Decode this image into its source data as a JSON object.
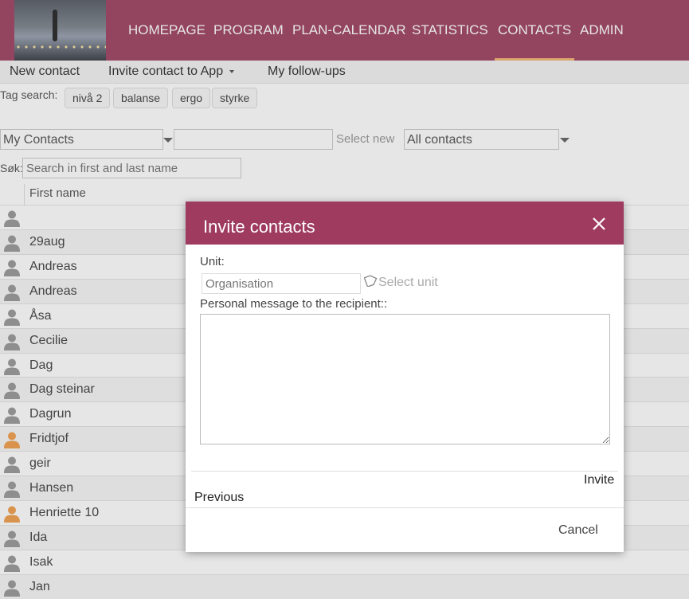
{
  "nav": {
    "items": [
      "HOMEPAGE",
      "PROGRAM",
      "PLAN-CALENDAR",
      "STATISTICS",
      "CONTACTS",
      "ADMIN"
    ],
    "active": "CONTACTS",
    "accent_color": "#a04565",
    "active_underline_color": "#f2b474"
  },
  "toolbar": {
    "new_contact": "New contact",
    "invite_contact": "Invite contact to App",
    "follow_ups": "My follow-ups"
  },
  "tag_search": {
    "label": "Tag search:",
    "tags": [
      "nivå 2",
      "balanse",
      "ergo",
      "styrke"
    ]
  },
  "filters": {
    "list_select": "My Contacts",
    "select_new_label": "Select new",
    "scope_select": "All contacts"
  },
  "search": {
    "label": "Søk:",
    "placeholder": "Search in first and last name"
  },
  "table": {
    "column_first_name": "First name",
    "rows": [
      {
        "name": "",
        "avatar": "gray"
      },
      {
        "name": "29aug",
        "avatar": "gray"
      },
      {
        "name": "Andreas",
        "avatar": "gray"
      },
      {
        "name": "Andreas",
        "avatar": "gray"
      },
      {
        "name": "Åsa",
        "avatar": "gray"
      },
      {
        "name": "Cecilie",
        "avatar": "gray"
      },
      {
        "name": "Dag",
        "avatar": "gray"
      },
      {
        "name": "Dag steinar",
        "avatar": "gray"
      },
      {
        "name": "Dagrun",
        "avatar": "gray"
      },
      {
        "name": "Fridtjof",
        "avatar": "orange"
      },
      {
        "name": "geir",
        "avatar": "gray"
      },
      {
        "name": "Hansen",
        "avatar": "gray"
      },
      {
        "name": "Henriette 10",
        "avatar": "orange"
      },
      {
        "name": "Ida",
        "avatar": "gray"
      },
      {
        "name": "Isak",
        "avatar": "gray"
      },
      {
        "name": "Jan",
        "avatar": "gray"
      }
    ],
    "avatar_colors": {
      "gray": "#9a9a9a",
      "orange": "#f0a050"
    }
  },
  "modal": {
    "title": "Invite contacts",
    "unit_label": "Unit:",
    "unit_placeholder": "Organisation",
    "select_unit": "Select unit",
    "message_label": "Personal message to the recipient::",
    "invite": "Invite",
    "previous": "Previous",
    "cancel": "Cancel",
    "header_color": "#9e3b5f"
  },
  "icons": {
    "close": "close-icon",
    "tag": "tag-icon",
    "user": "user-icon"
  }
}
